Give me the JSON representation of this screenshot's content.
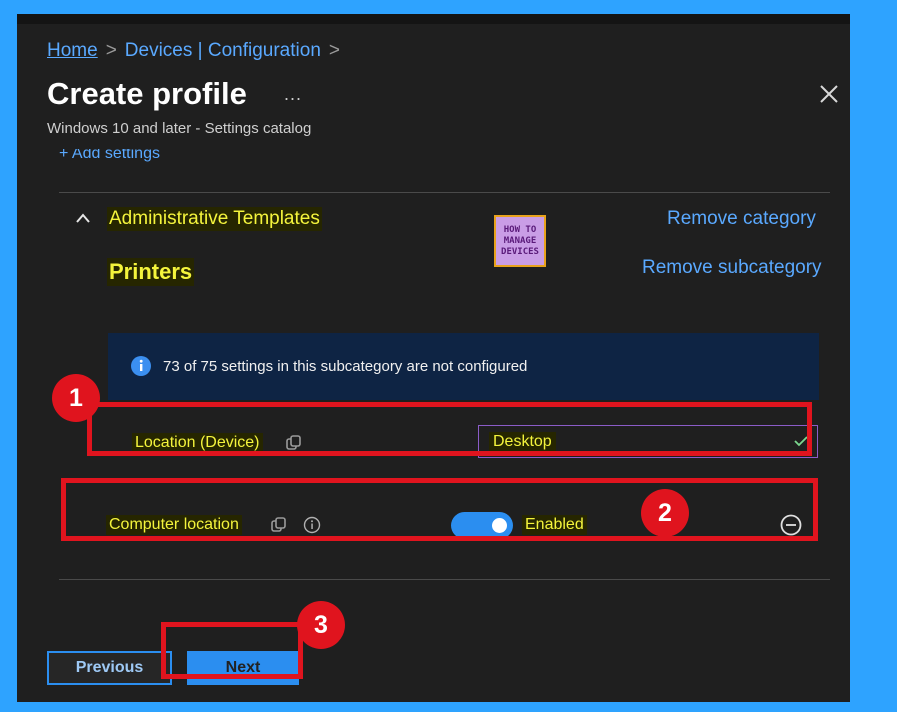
{
  "breadcrumb": {
    "home": "Home",
    "item2": "Devices | Configuration",
    "sep": ">"
  },
  "header": {
    "title": "Create profile",
    "more": "...",
    "subtitle": "Windows 10 and later - Settings catalog"
  },
  "add_settings": {
    "label": "+ Add settings",
    "icon": "info-icon"
  },
  "category": {
    "name": "Administrative Templates",
    "remove_category": "Remove category",
    "subcategory": "Printers",
    "remove_subcategory": "Remove subcategory"
  },
  "logo": {
    "line1": "HOW TO",
    "line2": "MANAGE",
    "line3": "DEVICES"
  },
  "info_banner": {
    "text": "73 of 75 settings in this subcategory are not configured",
    "icon": "info-icon"
  },
  "settings": [
    {
      "label": "Location (Device)",
      "value": "Desktop",
      "icon": "copy-icon"
    },
    {
      "label": "Computer location",
      "toggle_state": "Enabled",
      "icons": [
        "copy-icon",
        "info-icon",
        "remove-icon"
      ]
    }
  ],
  "annotations": {
    "badge1": "1",
    "badge2": "2",
    "badge3": "3"
  },
  "footer": {
    "previous": "Previous",
    "next": "Next"
  },
  "colors": {
    "background": "#2ea3ff",
    "panel": "#1f1f1f",
    "accent": "#2b8ef0",
    "link": "#5aa9ff",
    "highlight_text": "#f4f43c",
    "annotation": "#e0141e"
  }
}
